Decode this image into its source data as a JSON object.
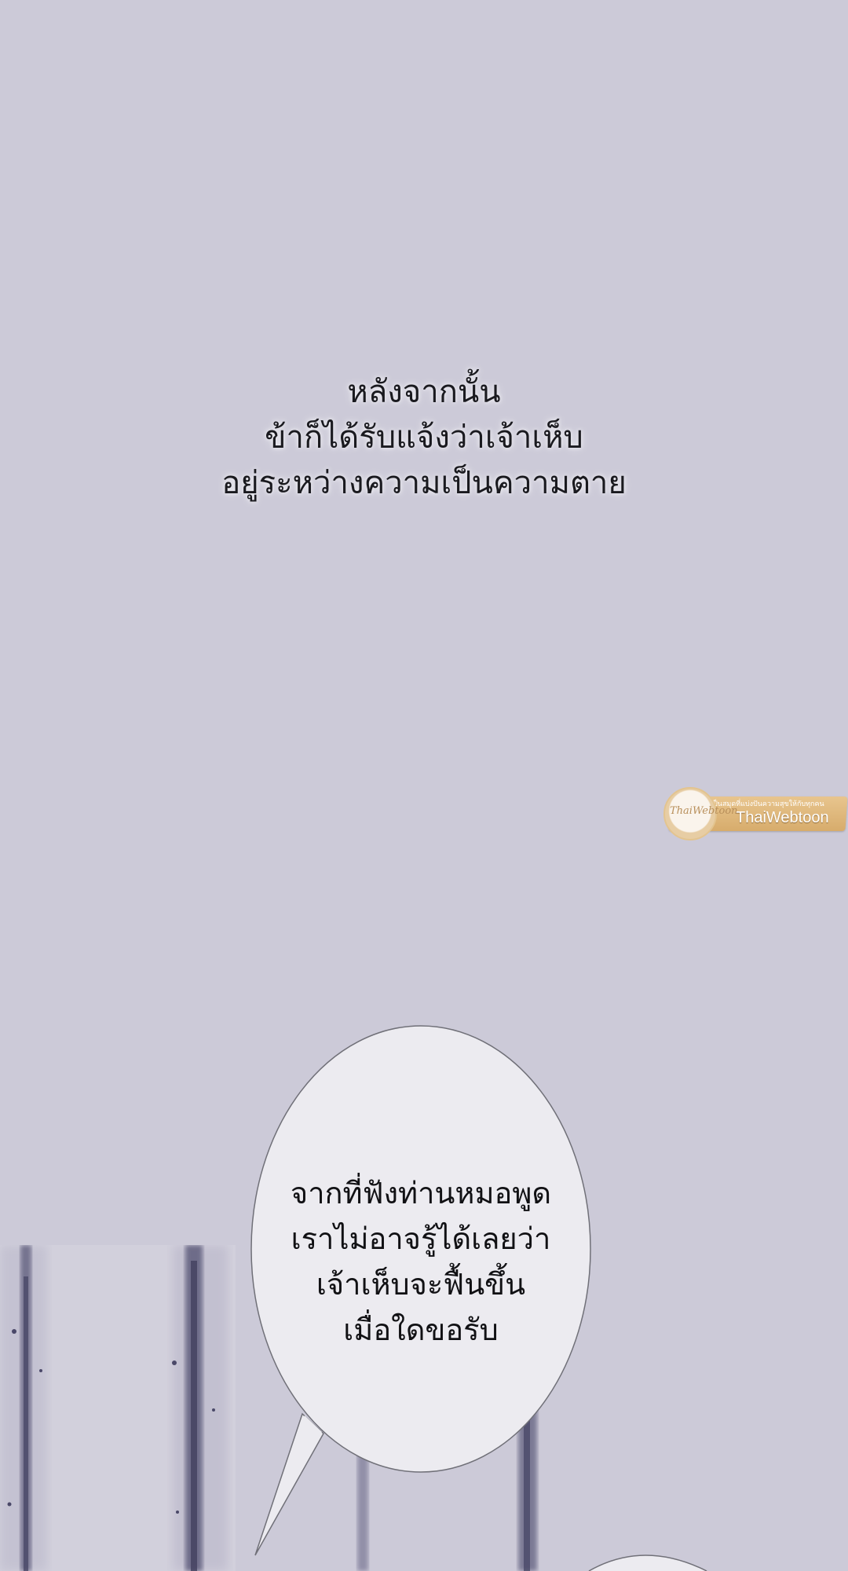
{
  "narration": {
    "line1": "หลังจากนั้น",
    "line2": "ข้าก็ได้รับแจ้งว่าเจ้าเห็บ",
    "line3": "อยู่ระหว่างความเป็นความตาย"
  },
  "speech_bubble": {
    "line1": "จากที่ฟังท่านหมอพูด",
    "line2": "เราไม่อาจรู้ได้เลยว่า",
    "line3": "เจ้าเห็บจะฟื้นขึ้น",
    "line4": "เมื่อใดขอรับ"
  },
  "watermark": {
    "name": "ThaiWebtoon",
    "tagline": "เป็นสมุดที่แบ่งปันความสุขให้กับทุกคน",
    "logo_text": "ThaiWebtoon"
  },
  "colors": {
    "background": "#cccad8",
    "bubble_fill": "#ecebf0",
    "ink_stroke": "#5a5878",
    "watermark_gold": "#dcb173"
  }
}
